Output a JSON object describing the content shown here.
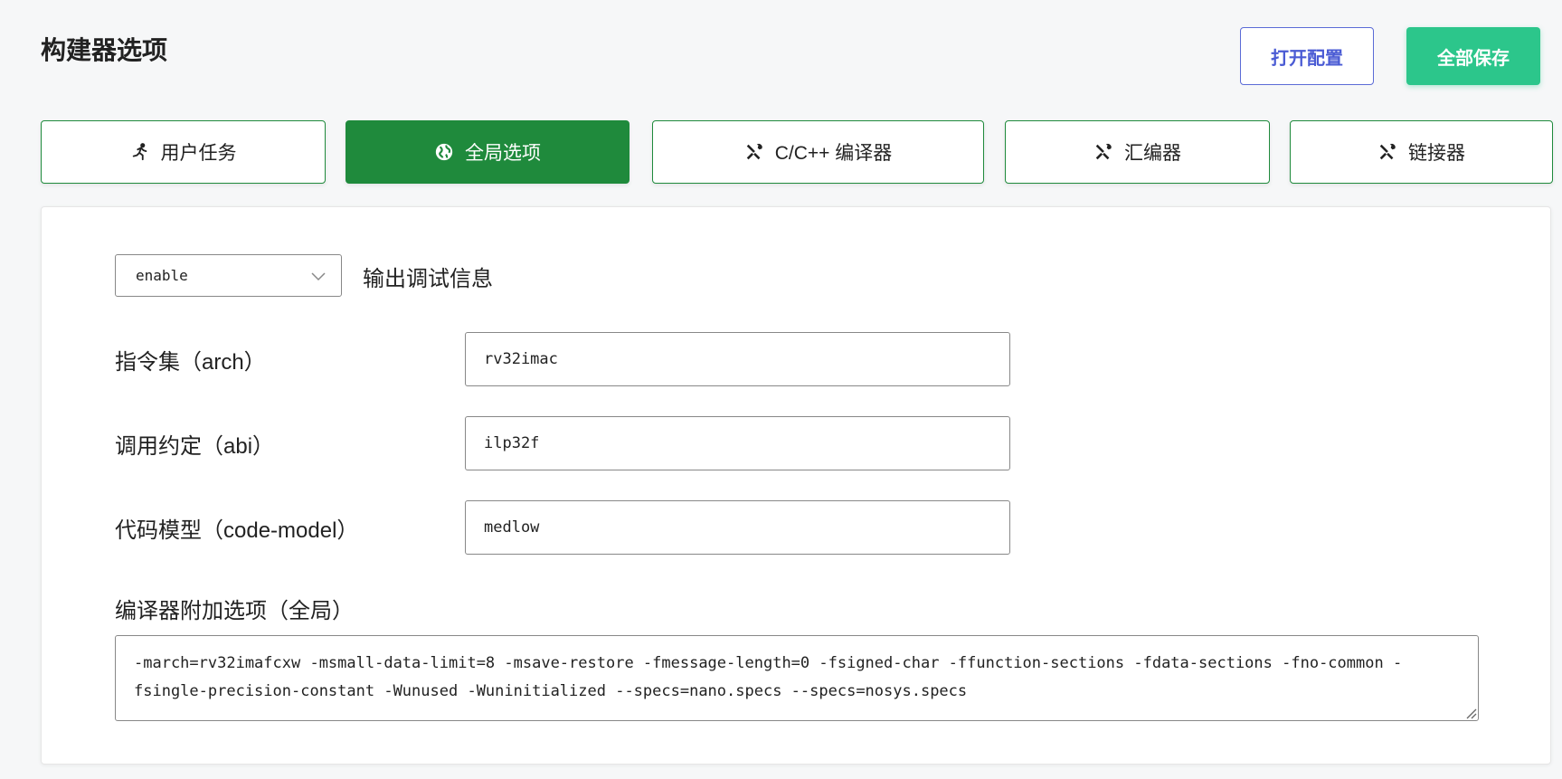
{
  "header": {
    "title": "构建器选项",
    "open_config_label": "打开配置",
    "save_all_label": "全部保存"
  },
  "tabs": [
    {
      "label": "用户任务",
      "icon": "user-task-icon",
      "active": false
    },
    {
      "label": "全局选项",
      "icon": "globe-icon",
      "active": true
    },
    {
      "label": "C/C++ 编译器",
      "icon": "tools-icon",
      "active": false
    },
    {
      "label": "汇编器",
      "icon": "tools-icon",
      "active": false
    },
    {
      "label": "链接器",
      "icon": "tools-icon",
      "active": false
    }
  ],
  "debug": {
    "selected": "enable",
    "label": "输出调试信息"
  },
  "fields": {
    "arch": {
      "label": "指令集（arch）",
      "value": "rv32imac"
    },
    "abi": {
      "label": "调用约定（abi）",
      "value": "ilp32f"
    },
    "code_model": {
      "label": "代码模型（code-model）",
      "value": "medlow"
    }
  },
  "extra": {
    "label": "编译器附加选项（全局）",
    "value": "-march=rv32imafcxw -msmall-data-limit=8 -msave-restore -fmessage-length=0 -fsigned-char -ffunction-sections -fdata-sections -fno-common -fsingle-precision-constant -Wunused -Wuninitialized --specs=nano.specs --specs=nosys.specs"
  },
  "colors": {
    "tab_active": "#1f8a3c",
    "save_button": "#2cc68b",
    "open_button": "#4a5bd4"
  }
}
